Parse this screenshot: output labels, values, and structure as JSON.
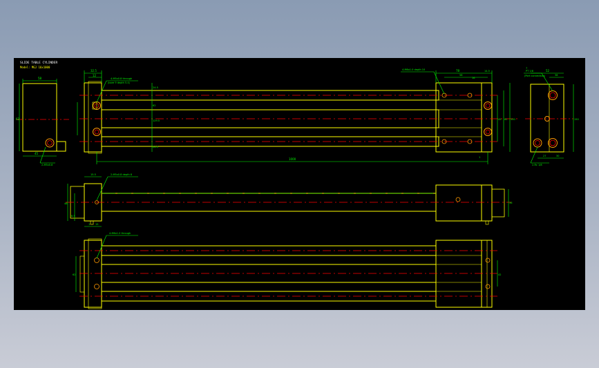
{
  "header": {
    "line1": "SLIDE TABLE CYLINDER",
    "line2": "Model: MGJ 16x1000"
  },
  "colors": {
    "background": "#000000",
    "outline": "#ffff00",
    "dimension": "#00ff00",
    "centerline": "#ff0000",
    "holes": "#ff9900"
  },
  "labels": {
    "callout_left_1": "4-M5x0.8 through",
    "callout_left_2": "(bore 9 depth 5.4)",
    "callout_right_top": "4-M6x1.0 depth 10",
    "callout_mid": "2-M5x0.8 depth 8",
    "callout_bot": "4-M6x1.0 through",
    "callout_end_1": "PT 1/8",
    "callout_end_2": "(Port connection)",
    "callout_side_bottom": "2-M5x0.8",
    "callout_end_bottom": "2-Rc 1/8"
  },
  "dims": {
    "side_top": "58",
    "side_bottom": "45",
    "side_left": "62",
    "top_a": "32.5",
    "top_b": "12",
    "stroke": "1000",
    "vert_1": "24.5",
    "vert_2": "62",
    "vert_3": "129.5",
    "vert_4": "24.5",
    "right_a": "78",
    "right_b": "58",
    "right_c": "16",
    "right_d": "5",
    "right_e": "14.5",
    "right_h1": "45",
    "right_h2": "82",
    "right_h3": "150",
    "bottom_1": "1",
    "end_top_a": "52",
    "end_top_b": "38",
    "end_top_c": "7",
    "end_h": "150",
    "end_b1": "27",
    "end_b2": "30",
    "mid_left": "48",
    "mid_left2": "6.5",
    "mid_a": "1",
    "mid_b": "15",
    "mid_right": "36",
    "mid_top": "15.5",
    "bot_left": "62",
    "bot_right": "42"
  }
}
